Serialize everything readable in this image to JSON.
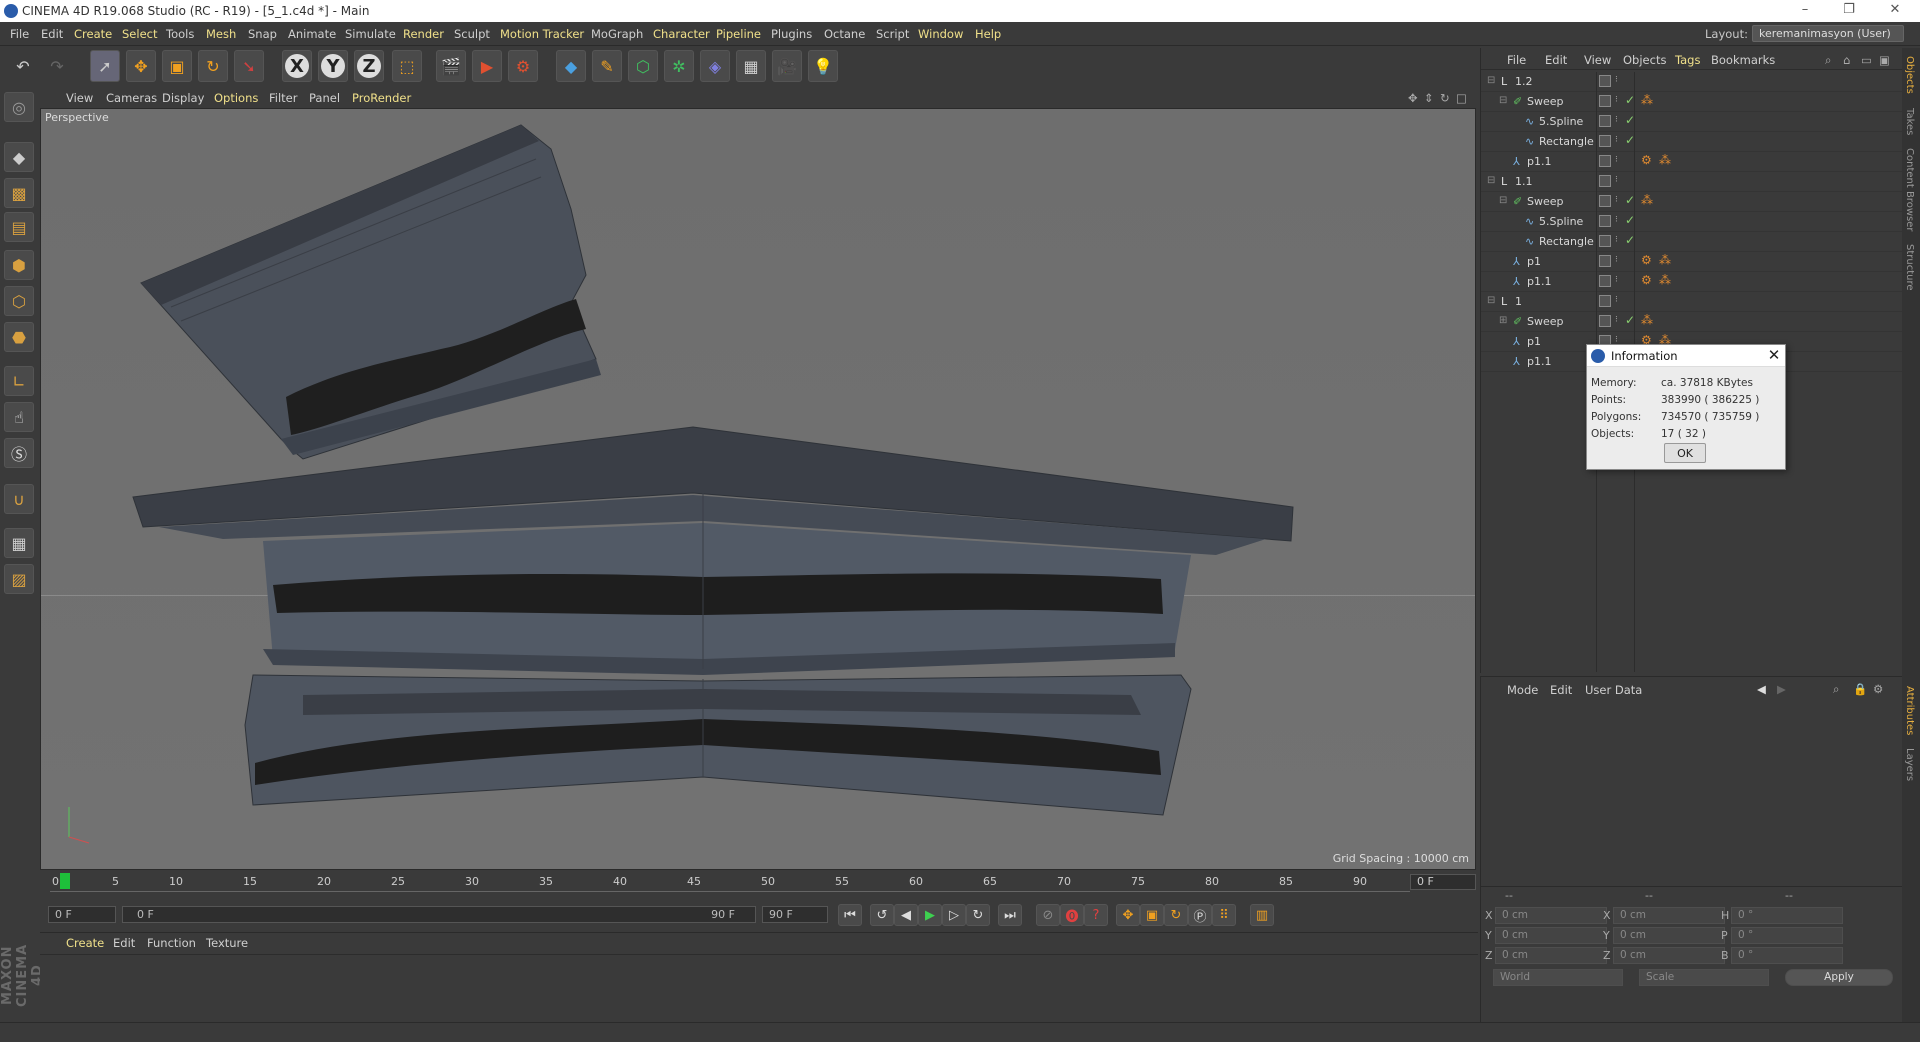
{
  "window": {
    "title": "CINEMA 4D R19.068 Studio (RC - R19) - [5_1.c4d *] - Main",
    "min_icon": "minimize-icon",
    "max_icon": "restore-icon",
    "close_icon": "close-icon"
  },
  "menu": [
    "File",
    "Edit",
    "Create",
    "Select",
    "Tools",
    "Mesh",
    "Snap",
    "Animate",
    "Simulate",
    "Render",
    "Sculpt",
    "Motion Tracker",
    "MoGraph",
    "Character",
    "Pipeline",
    "Plugins",
    "Octane",
    "Script",
    "Window",
    "Help"
  ],
  "layout": {
    "label": "Layout:",
    "value": "keremanimasyon (User)"
  },
  "toolbar_icons": [
    "undo-icon",
    "redo-icon",
    "live-selection-icon",
    "move-icon",
    "scale-icon",
    "rotate-icon",
    "recent-tools-icon",
    "x-axis-lock-icon",
    "y-axis-lock-icon",
    "z-axis-lock-icon",
    "coordinate-system-icon",
    "render-view-icon",
    "render-picture-viewer-icon",
    "edit-render-settings-icon",
    "cube-icon",
    "pen-spline-icon",
    "subdivision-surface-icon",
    "cloner-icon",
    "deformer-icon",
    "floor-icon",
    "camera-icon",
    "light-icon"
  ],
  "axis_letters": {
    "x": "X",
    "y": "Y",
    "z": "Z"
  },
  "viewport_menu": [
    "View",
    "Cameras",
    "Display",
    "Options",
    "Filter",
    "Panel",
    "ProRender"
  ],
  "viewport": {
    "label": "Perspective",
    "grid_spacing": "Grid Spacing : 10000 cm"
  },
  "timeline": {
    "ticks": [
      "0",
      "5",
      "10",
      "15",
      "20",
      "25",
      "30",
      "35",
      "40",
      "45",
      "50",
      "55",
      "60",
      "65",
      "70",
      "75",
      "80",
      "85",
      "90"
    ],
    "frame_box": "0 F",
    "current_frame": "0 F",
    "slider_start": "0 F",
    "slider_end": "90 F",
    "end_frame": "90 F"
  },
  "material_menu": [
    "Create",
    "Edit",
    "Function",
    "Texture"
  ],
  "object_menu": [
    "File",
    "Edit",
    "View",
    "Objects",
    "Tags",
    "Bookmarks"
  ],
  "objects": [
    {
      "name": "1.2",
      "type": "null",
      "indent": 0,
      "expanded": true,
      "check": false,
      "tags": 0
    },
    {
      "name": "Sweep",
      "type": "sweep",
      "indent": 1,
      "expanded": true,
      "check": true,
      "tags": 1
    },
    {
      "name": "5.Spline",
      "type": "spline",
      "indent": 2,
      "check": true,
      "tags": 0
    },
    {
      "name": "Rectangle",
      "type": "spline",
      "indent": 2,
      "check": true,
      "tags": 0
    },
    {
      "name": "p1.1",
      "type": "joint",
      "indent": 1,
      "check": false,
      "tags": 2
    },
    {
      "name": "1.1",
      "type": "null",
      "indent": 0,
      "expanded": true,
      "check": false,
      "tags": 0
    },
    {
      "name": "Sweep",
      "type": "sweep",
      "indent": 1,
      "expanded": true,
      "check": true,
      "tags": 1
    },
    {
      "name": "5.Spline",
      "type": "spline",
      "indent": 2,
      "check": true,
      "tags": 0
    },
    {
      "name": "Rectangle",
      "type": "spline",
      "indent": 2,
      "check": true,
      "tags": 0
    },
    {
      "name": "p1",
      "type": "joint",
      "indent": 1,
      "check": false,
      "tags": 2
    },
    {
      "name": "p1.1",
      "type": "joint",
      "indent": 1,
      "check": false,
      "tags": 2
    },
    {
      "name": "1",
      "type": "null",
      "indent": 0,
      "expanded": true,
      "check": false,
      "tags": 0
    },
    {
      "name": "Sweep",
      "type": "sweep",
      "indent": 1,
      "expanded": false,
      "check": true,
      "tags": 1
    },
    {
      "name": "p1",
      "type": "joint",
      "indent": 1,
      "check": false,
      "tags": 2
    },
    {
      "name": "p1.1",
      "type": "joint",
      "indent": 1,
      "check": false,
      "tags": 0
    }
  ],
  "attributes_menu": [
    "Mode",
    "Edit",
    "User Data"
  ],
  "coords": {
    "rows": [
      {
        "a": "X",
        "av": "0 cm",
        "b": "X",
        "bv": "0 cm",
        "c": "H",
        "cv": "0 °"
      },
      {
        "a": "Y",
        "av": "0 cm",
        "b": "Y",
        "bv": "0 cm",
        "c": "P",
        "cv": "0 °"
      },
      {
        "a": "Z",
        "av": "0 cm",
        "b": "Z",
        "bv": "0 cm",
        "c": "B",
        "cv": "0 °"
      }
    ],
    "world": "World",
    "scale": "Scale",
    "apply": "Apply",
    "headers": [
      "--",
      "--",
      "--"
    ]
  },
  "side_tabs": [
    "Objects",
    "Takes",
    "Content Browser",
    "Structure",
    "Attributes",
    "Layers"
  ],
  "brand": "MAXON CINEMA 4D",
  "dialog": {
    "title": "Information",
    "fields": [
      {
        "key": "Memory:",
        "value": "ca. 37818 KBytes"
      },
      {
        "key": "Points:",
        "value": "383990 ( 386225 )"
      },
      {
        "key": "Polygons:",
        "value": "734570 ( 735759 )"
      },
      {
        "key": "Objects:",
        "value": "17 ( 32 )"
      }
    ],
    "ok": "OK"
  }
}
